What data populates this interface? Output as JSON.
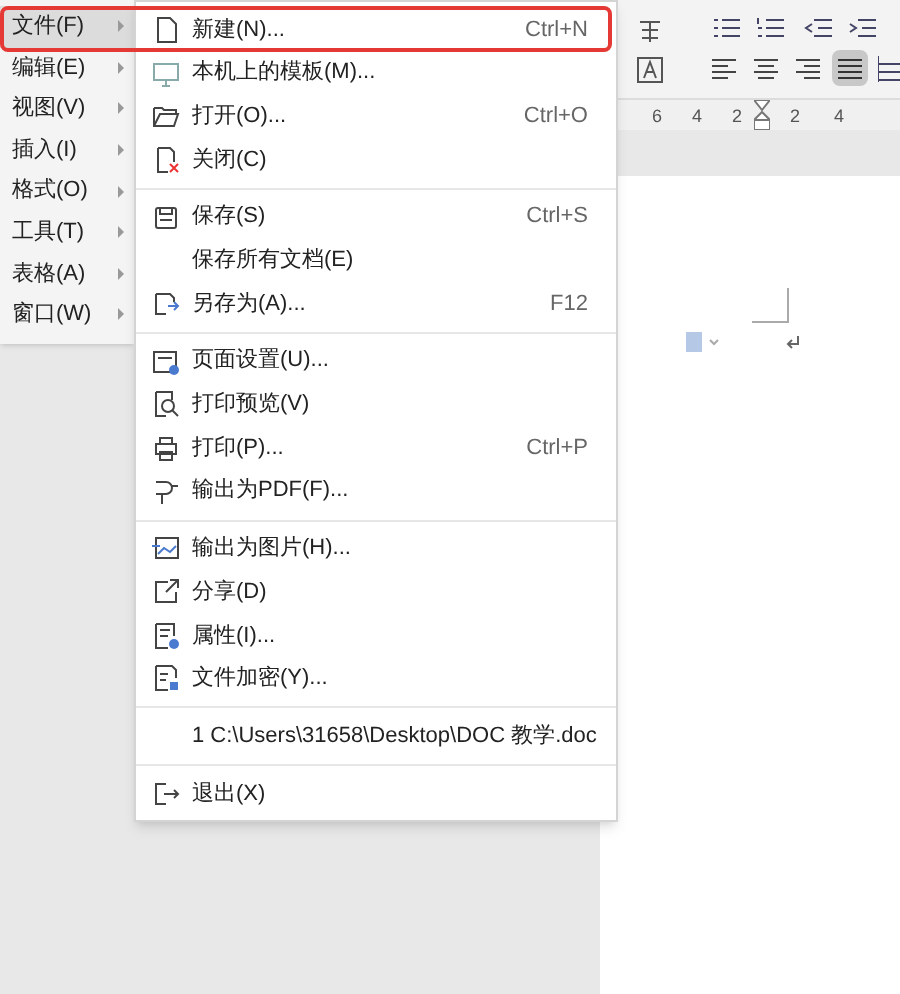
{
  "menu_bar": [
    {
      "label": "文件(F)",
      "selected": true
    },
    {
      "label": "编辑(E)",
      "selected": false
    },
    {
      "label": "视图(V)",
      "selected": false
    },
    {
      "label": "插入(I)",
      "selected": false
    },
    {
      "label": "格式(O)",
      "selected": false
    },
    {
      "label": "工具(T)",
      "selected": false
    },
    {
      "label": "表格(A)",
      "selected": false
    },
    {
      "label": "窗口(W)",
      "selected": false
    }
  ],
  "file_menu": [
    [
      {
        "kind": "new",
        "label": "新建(N)...",
        "shortcut": "Ctrl+N"
      },
      {
        "kind": "template",
        "label": "本机上的模板(M)..."
      },
      {
        "kind": "open",
        "label": "打开(O)...",
        "shortcut": "Ctrl+O"
      },
      {
        "kind": "close",
        "label": "关闭(C)"
      }
    ],
    [
      {
        "kind": "save",
        "label": "保存(S)",
        "shortcut": "Ctrl+S"
      },
      {
        "kind": "text",
        "label": "保存所有文档(E)"
      },
      {
        "kind": "saveas",
        "label": "另存为(A)...",
        "shortcut": "F12"
      }
    ],
    [
      {
        "kind": "pagesetup",
        "label": "页面设置(U)..."
      },
      {
        "kind": "preview",
        "label": "打印预览(V)"
      },
      {
        "kind": "print",
        "label": "打印(P)...",
        "shortcut": "Ctrl+P"
      },
      {
        "kind": "pdf",
        "label": "输出为PDF(F)..."
      }
    ],
    [
      {
        "kind": "image",
        "label": "输出为图片(H)..."
      },
      {
        "kind": "share",
        "label": "分享(D)"
      },
      {
        "kind": "properties",
        "label": "属性(I)..."
      },
      {
        "kind": "encrypt",
        "label": "文件加密(Y)..."
      }
    ],
    [
      {
        "kind": "text",
        "label": "1 C:\\Users\\31658\\Desktop\\DOC 教学.doc"
      }
    ],
    [
      {
        "kind": "exit",
        "label": "退出(X)"
      }
    ]
  ],
  "annotation_box": true,
  "ruler": {
    "ticks": [
      "6",
      "4",
      "2",
      "2",
      "4"
    ]
  }
}
